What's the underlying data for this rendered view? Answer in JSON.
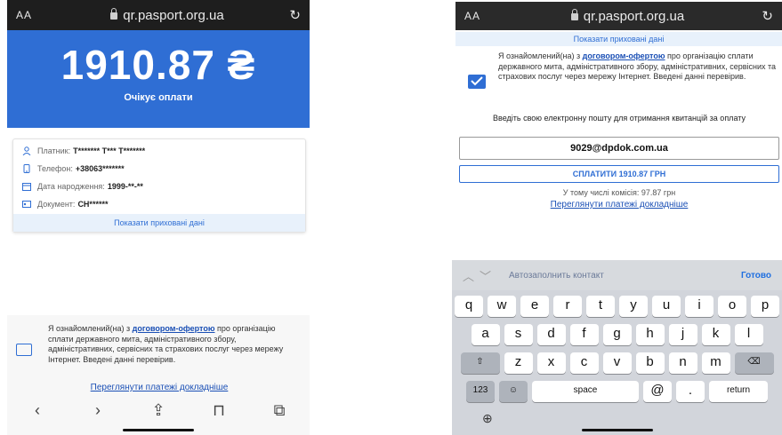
{
  "browser": {
    "aa_label": "AA",
    "url": "qr.pasport.org.ua"
  },
  "payment": {
    "amount": "1910.87 ₴",
    "status": "Очікує оплати"
  },
  "info": {
    "payer_label": "Платник:",
    "payer_value": "Т******* Т*** Т*******",
    "phone_label": "Телефон:",
    "phone_value": "+38063*******",
    "birth_label": "Дата народження:",
    "birth_value": "1999-**-**",
    "doc_label": "Документ:",
    "doc_value": "СН******",
    "show_hidden": "Показати приховані дані"
  },
  "agreement": {
    "prefix": "Я ознайомлений(на) з ",
    "link": "договором-офертою",
    "suffix": " про організацію сплати державного мита, адміністративного збору, адміністративних, сервісних та страхових послуг через мережу Інтернет. Введені данні перевірив."
  },
  "links": {
    "details": "Переглянути платежі докладніше"
  },
  "email": {
    "label": "Введіть свою електронну пошту для отримання квитанцій за оплату",
    "value": "9029@dpdok.com.ua"
  },
  "pay_button": "СПЛАТИТИ 1910.87 ГРН",
  "commission": "У тому числі комісія: 97.87 грн",
  "keyboard": {
    "autofill": "Автозаполнить контакт",
    "done": "Готово",
    "row1": [
      "q",
      "w",
      "e",
      "r",
      "t",
      "y",
      "u",
      "i",
      "o",
      "p"
    ],
    "row2": [
      "a",
      "s",
      "d",
      "f",
      "g",
      "h",
      "j",
      "k",
      "l"
    ],
    "row3": [
      "z",
      "x",
      "c",
      "v",
      "b",
      "n",
      "m"
    ],
    "num_key": "123",
    "space": "space",
    "at": "@",
    "dot": ".",
    "return": "return"
  },
  "colors": {
    "accent": "#2f6ed4",
    "link": "#1a4fb5"
  }
}
